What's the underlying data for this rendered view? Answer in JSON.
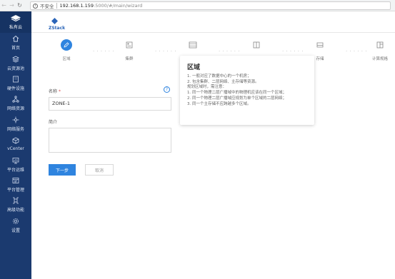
{
  "browser": {
    "security_label": "不安全",
    "url_host": "192.168.1.159",
    "url_path": ":5000/#/main/wizard"
  },
  "sidebar": {
    "logo_label": "私有云",
    "items": [
      {
        "label": "首页",
        "icon": "home-icon"
      },
      {
        "label": "云资源池",
        "icon": "cloud-icon"
      },
      {
        "label": "硬件设施",
        "icon": "building-icon"
      },
      {
        "label": "网络资源",
        "icon": "network-icon"
      },
      {
        "label": "网络服务",
        "icon": "network-service-icon"
      },
      {
        "label": "vCenter",
        "icon": "cube-icon"
      },
      {
        "label": "平台运维",
        "icon": "monitor-icon"
      },
      {
        "label": "平台管理",
        "icon": "manage-icon"
      },
      {
        "label": "高级功能",
        "icon": "advanced-icon"
      },
      {
        "label": "设置",
        "icon": "settings-icon"
      }
    ]
  },
  "header": {
    "brand": "ZStack"
  },
  "wizard": {
    "steps": [
      {
        "label": "区域",
        "icon": "pencil-icon",
        "active": true
      },
      {
        "label": "集群",
        "icon": "cluster-icon",
        "active": false
      },
      {
        "label": "",
        "icon": "host-icon",
        "active": false
      },
      {
        "label": "",
        "icon": "storage-icon",
        "active": false
      },
      {
        "label": "存储",
        "icon": "disk-icon",
        "active": false
      },
      {
        "label": "计算规格",
        "icon": "spec-icon",
        "active": false
      }
    ]
  },
  "form": {
    "name_label": "名称",
    "required_mark": "*",
    "name_value": "ZONE-1",
    "desc_label": "简介",
    "desc_value": "",
    "next_label": "下一步",
    "cancel_label": "取消"
  },
  "popover": {
    "title": "区域",
    "lines": [
      "1. 一般对应了数据中心的一个机房；",
      "2. 包含集群、二层网络、主存储等资源。",
      "规划区域时，需注意：",
      "1. 同一个物理二层广播域中的物理机应该在同一个区域；",
      "2. 同一个物理二层广播域应规划为单个区域的二层网络；",
      "3. 同一个主存储不应跨越多个区域。"
    ]
  }
}
